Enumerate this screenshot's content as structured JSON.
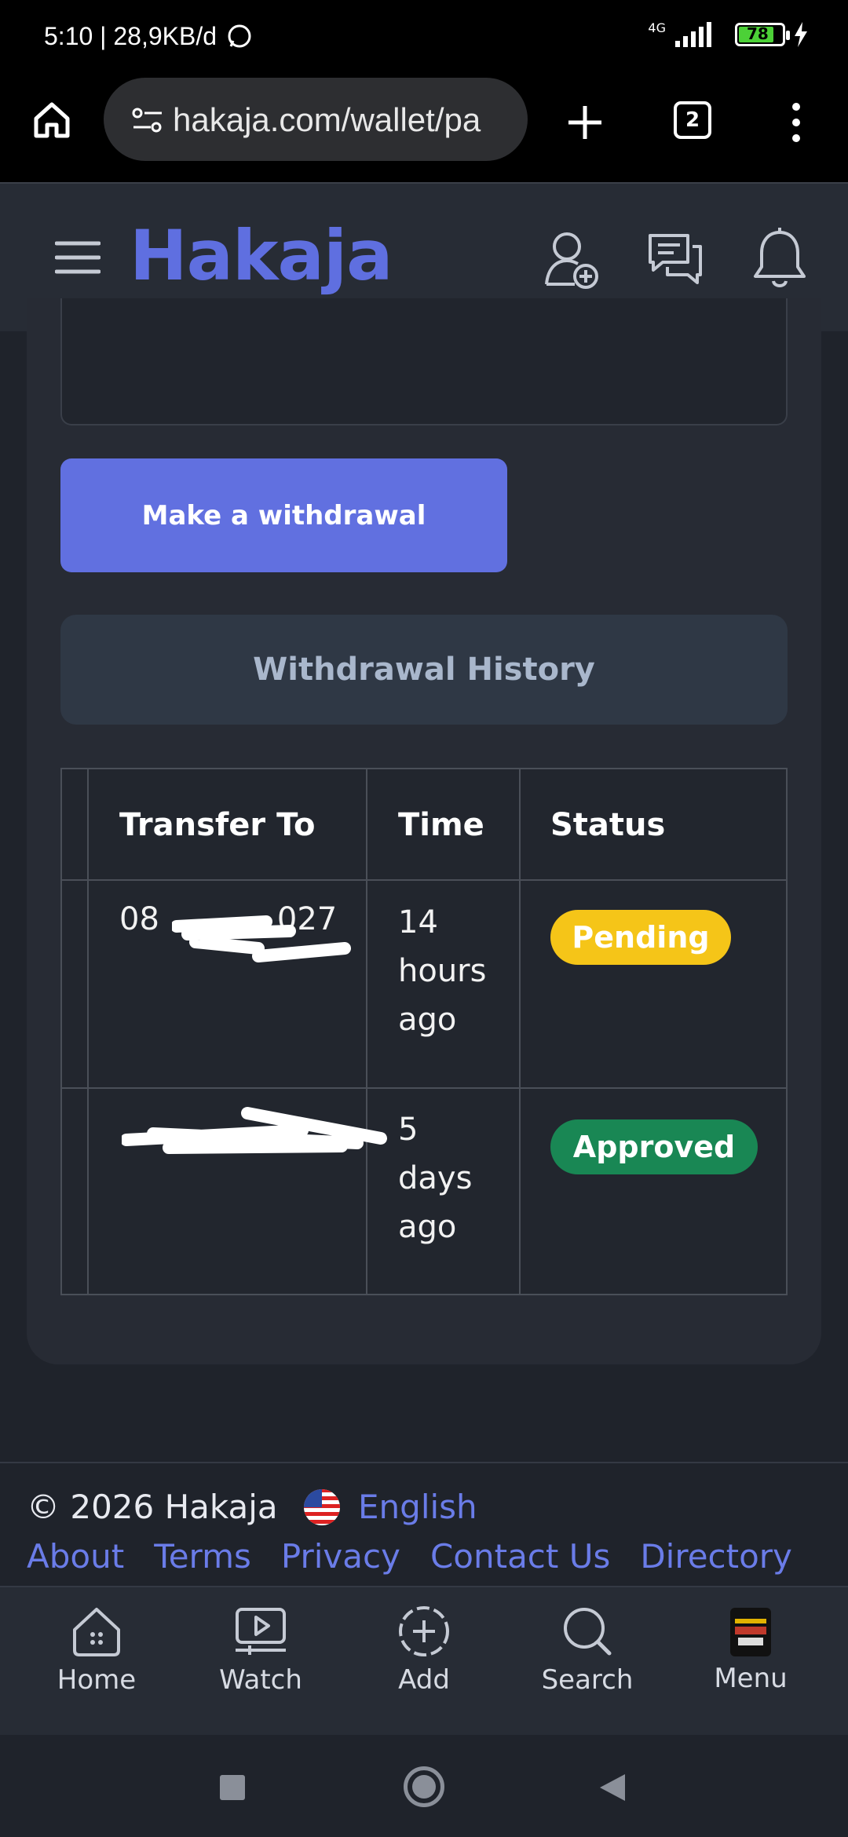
{
  "status_bar": {
    "time": "5:10 | 28,9KB/d",
    "network": "4G",
    "battery": "78"
  },
  "browser": {
    "url": "hakaja.com/wallet/pa",
    "tab_count": "2"
  },
  "header": {
    "brand": "Hakaja"
  },
  "actions": {
    "withdraw_label": "Make a withdrawal",
    "history_label": "Withdrawal History"
  },
  "table": {
    "columns": [
      "Transfer To",
      "Time",
      "Status"
    ],
    "rows": [
      {
        "transfer_to": "08",
        "transfer_to_tail": "027",
        "time_lines": [
          "14",
          "hours",
          "ago"
        ],
        "status": "Pending"
      },
      {
        "transfer_to": "",
        "transfer_to_tail": "",
        "time_lines": [
          "5",
          "days",
          "ago"
        ],
        "status": "Approved"
      }
    ]
  },
  "footer": {
    "copyright": "© 2026 Hakaja",
    "language": "English",
    "links": [
      "About",
      "Terms",
      "Privacy",
      "Contact Us",
      "Directory"
    ]
  },
  "bottom_nav": [
    {
      "label": "Home",
      "icon": "home-icon"
    },
    {
      "label": "Watch",
      "icon": "video-icon"
    },
    {
      "label": "Add",
      "icon": "add-icon"
    },
    {
      "label": "Search",
      "icon": "search-icon"
    },
    {
      "label": "Menu",
      "icon": "menu-avatar"
    }
  ],
  "colors": {
    "accent": "#6170e0",
    "pending": "#f5c518",
    "approved": "#198754"
  }
}
